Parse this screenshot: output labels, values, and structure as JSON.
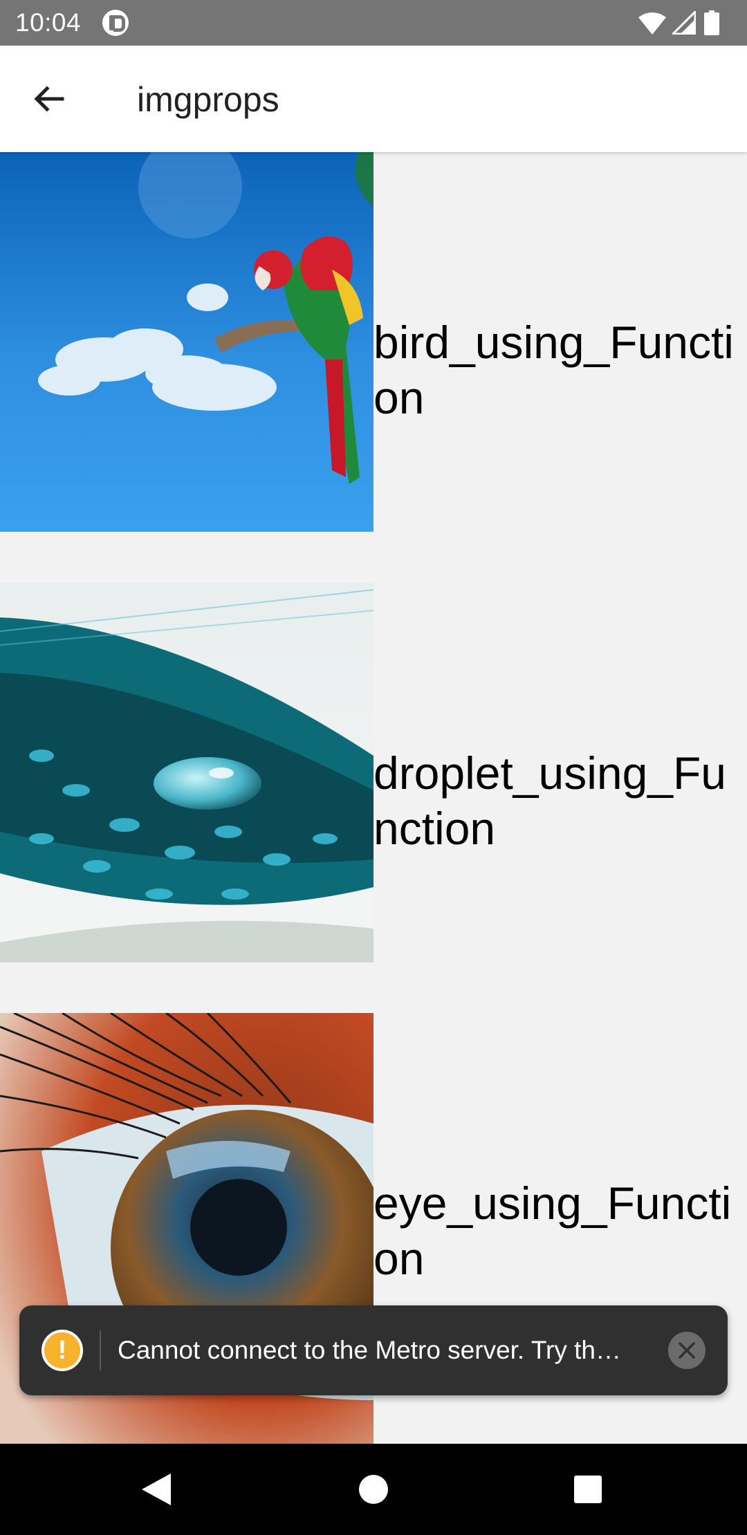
{
  "status_bar": {
    "time": "10:04",
    "icons": [
      "app-notification-icon",
      "wifi-icon",
      "cell-signal-icon",
      "battery-icon"
    ]
  },
  "app_bar": {
    "title": "imgprops",
    "back_icon": "arrow-left-icon"
  },
  "list": {
    "items": [
      {
        "label": "bird_using_Function",
        "image": "parrot-on-branch-sky"
      },
      {
        "label": "droplet_using_Function",
        "image": "water-droplet-on-teal-feather"
      },
      {
        "label": "eye_using_Function",
        "image": "close-up-human-eye"
      }
    ]
  },
  "toast": {
    "message": "Cannot connect to the Metro server.  Try th…",
    "icon": "warning-icon",
    "close_icon": "close-icon",
    "accent_color": "#f7b32b"
  },
  "nav_bar": {
    "buttons": [
      "back-triangle-icon",
      "home-circle-icon",
      "recents-square-icon"
    ]
  }
}
